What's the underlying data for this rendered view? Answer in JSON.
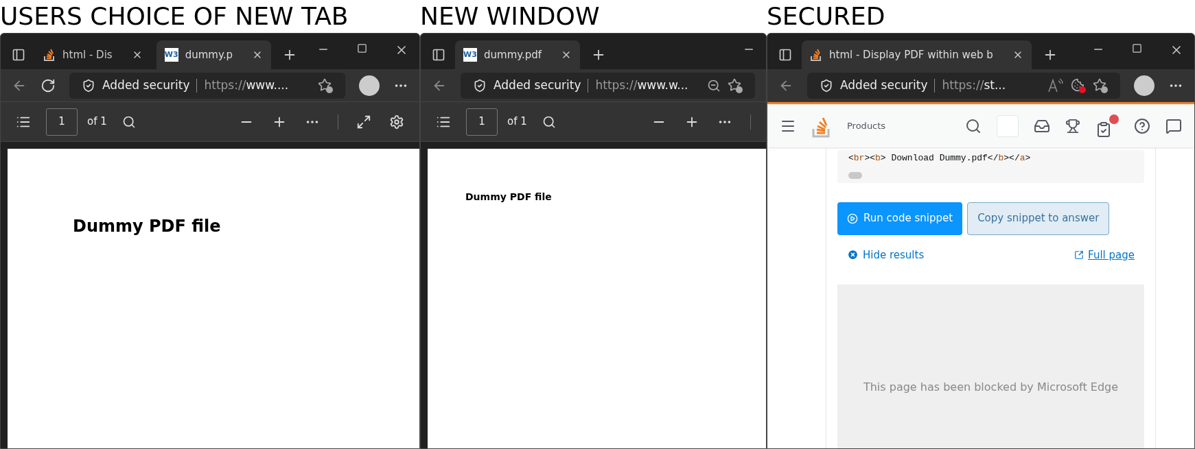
{
  "panels": [
    {
      "caption": "USERS CHOICE OF NEW TAB",
      "tabs": [
        {
          "title": "html - Dis",
          "kind": "stack",
          "selected": false
        },
        {
          "title": "dummy.p",
          "kind": "w3",
          "favicon_label": "W3",
          "selected": true
        }
      ],
      "window_controls": [
        {
          "kind": "minimize"
        },
        {
          "kind": "maximize"
        },
        {
          "kind": "close"
        }
      ],
      "nav": [
        {
          "kind": "back"
        },
        {
          "kind": "refresh"
        }
      ],
      "address": {
        "security": "Added security",
        "url_scheme": "https://",
        "url_host": "www...."
      },
      "address_icons": [
        {
          "kind": "favorite"
        }
      ],
      "profile": true,
      "pdf_toolbar": {
        "page": "1",
        "total": "of 1",
        "tools": [
          {
            "kind": "zoomout"
          },
          {
            "kind": "zoomin"
          },
          {
            "kind": "more"
          },
          {
            "kind": "divider"
          },
          {
            "kind": "fit"
          },
          {
            "kind": "settings"
          }
        ]
      },
      "content": {
        "kind": "pdflarge",
        "heading": "Dummy PDF file"
      }
    },
    {
      "caption": "NEW WINDOW",
      "tabs": [
        {
          "title": "dummy.pdf",
          "kind": "w3",
          "favicon_label": "W3",
          "selected": true
        }
      ],
      "window_controls": [
        {
          "kind": "minimize"
        }
      ],
      "nav": [
        {
          "kind": "back"
        }
      ],
      "address": {
        "security": "Added security",
        "url_scheme": "https://",
        "url_host": "www.w..."
      },
      "address_icons": [
        {
          "kind": "zoomout"
        },
        {
          "kind": "favorite"
        }
      ],
      "profile": false,
      "pdf_toolbar": {
        "page": "1",
        "total": "of 1",
        "tools": [
          {
            "kind": "zoomout"
          },
          {
            "kind": "zoomin"
          },
          {
            "kind": "more"
          },
          {
            "kind": "divider"
          }
        ]
      },
      "content": {
        "kind": "pdfsmall",
        "heading": "Dummy PDF file"
      }
    },
    {
      "caption": "SECURED",
      "tabs": [
        {
          "title": "html - Display PDF within web b",
          "kind": "stack",
          "selected": true
        }
      ],
      "window_controls": [
        {
          "kind": "minimize"
        },
        {
          "kind": "maximize"
        },
        {
          "kind": "close"
        }
      ],
      "nav": [
        {
          "kind": "back"
        }
      ],
      "address": {
        "security": "Added security",
        "url_scheme": "https://",
        "url_host": "st..."
      },
      "address_icons": [
        {
          "kind": "readaloud"
        },
        {
          "kind": "cookieblocked"
        },
        {
          "kind": "favorite"
        }
      ],
      "profile": true,
      "content": {
        "kind": "stackoverflow",
        "nav_label": "Products",
        "code": [
          {
            "kind": "punct",
            "text": "<"
          },
          {
            "kind": "tag",
            "text": "br"
          },
          {
            "kind": "punct",
            "text": "><"
          },
          {
            "kind": "tag",
            "text": "b"
          },
          {
            "kind": "punct",
            "text": "> Download Dummy.pdf</"
          },
          {
            "kind": "tag",
            "text": "b"
          },
          {
            "kind": "punct",
            "text": "></"
          },
          {
            "kind": "tag",
            "text": "a"
          },
          {
            "kind": "punct",
            "text": ">"
          }
        ],
        "run_button": "Run code snippet",
        "copy_button": "Copy snippet to answer",
        "hide_results": "Hide results",
        "full_page": "Full page",
        "blocked_message": "This page has been blocked by Microsoft Edge"
      }
    }
  ]
}
